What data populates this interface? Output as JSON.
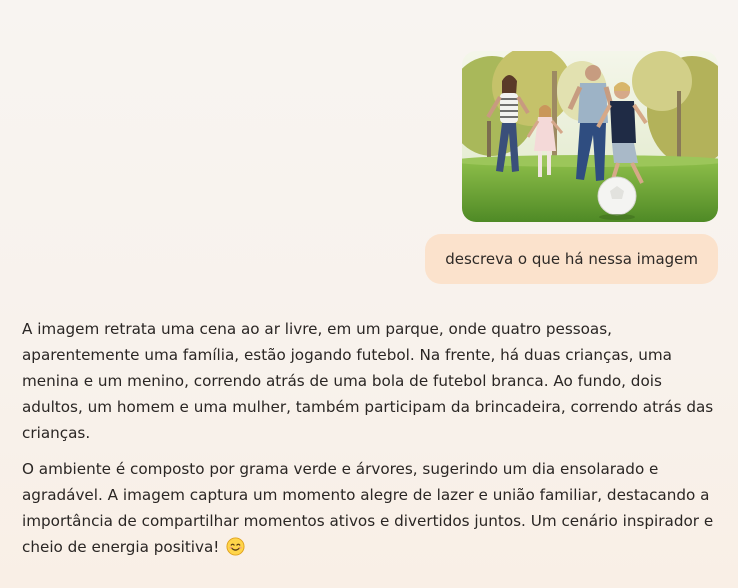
{
  "conversation": {
    "user_message": {
      "image_icon": "photo-family-playing-soccer-in-park",
      "text": "descreva o que há nessa imagem"
    },
    "assistant_message": {
      "paragraph_1": "A imagem retrata uma cena ao ar livre, em um parque, onde quatro pessoas, aparentemente uma família, estão jogando futebol. Na frente, há duas crianças, uma menina e um menino, correndo atrás de uma bola de futebol branca. Ao fundo, dois adultos, um homem e uma mulher, também participam da brincadeira, correndo atrás das crianças.",
      "paragraph_2": "O ambiente é composto por grama verde e árvores, sugerindo um dia ensolarado e agradável. A imagem captura um momento alegre de lazer e união familiar, destacando a importância de compartilhar momentos ativos e divertidos juntos. Um cenário inspirador e cheio de energia positiva!",
      "trailing_emoji": "smiling-face-icon"
    }
  },
  "colors": {
    "background": "#f8f4f1",
    "user_bubble": "#fbe2cc",
    "text": "#2a2624"
  }
}
